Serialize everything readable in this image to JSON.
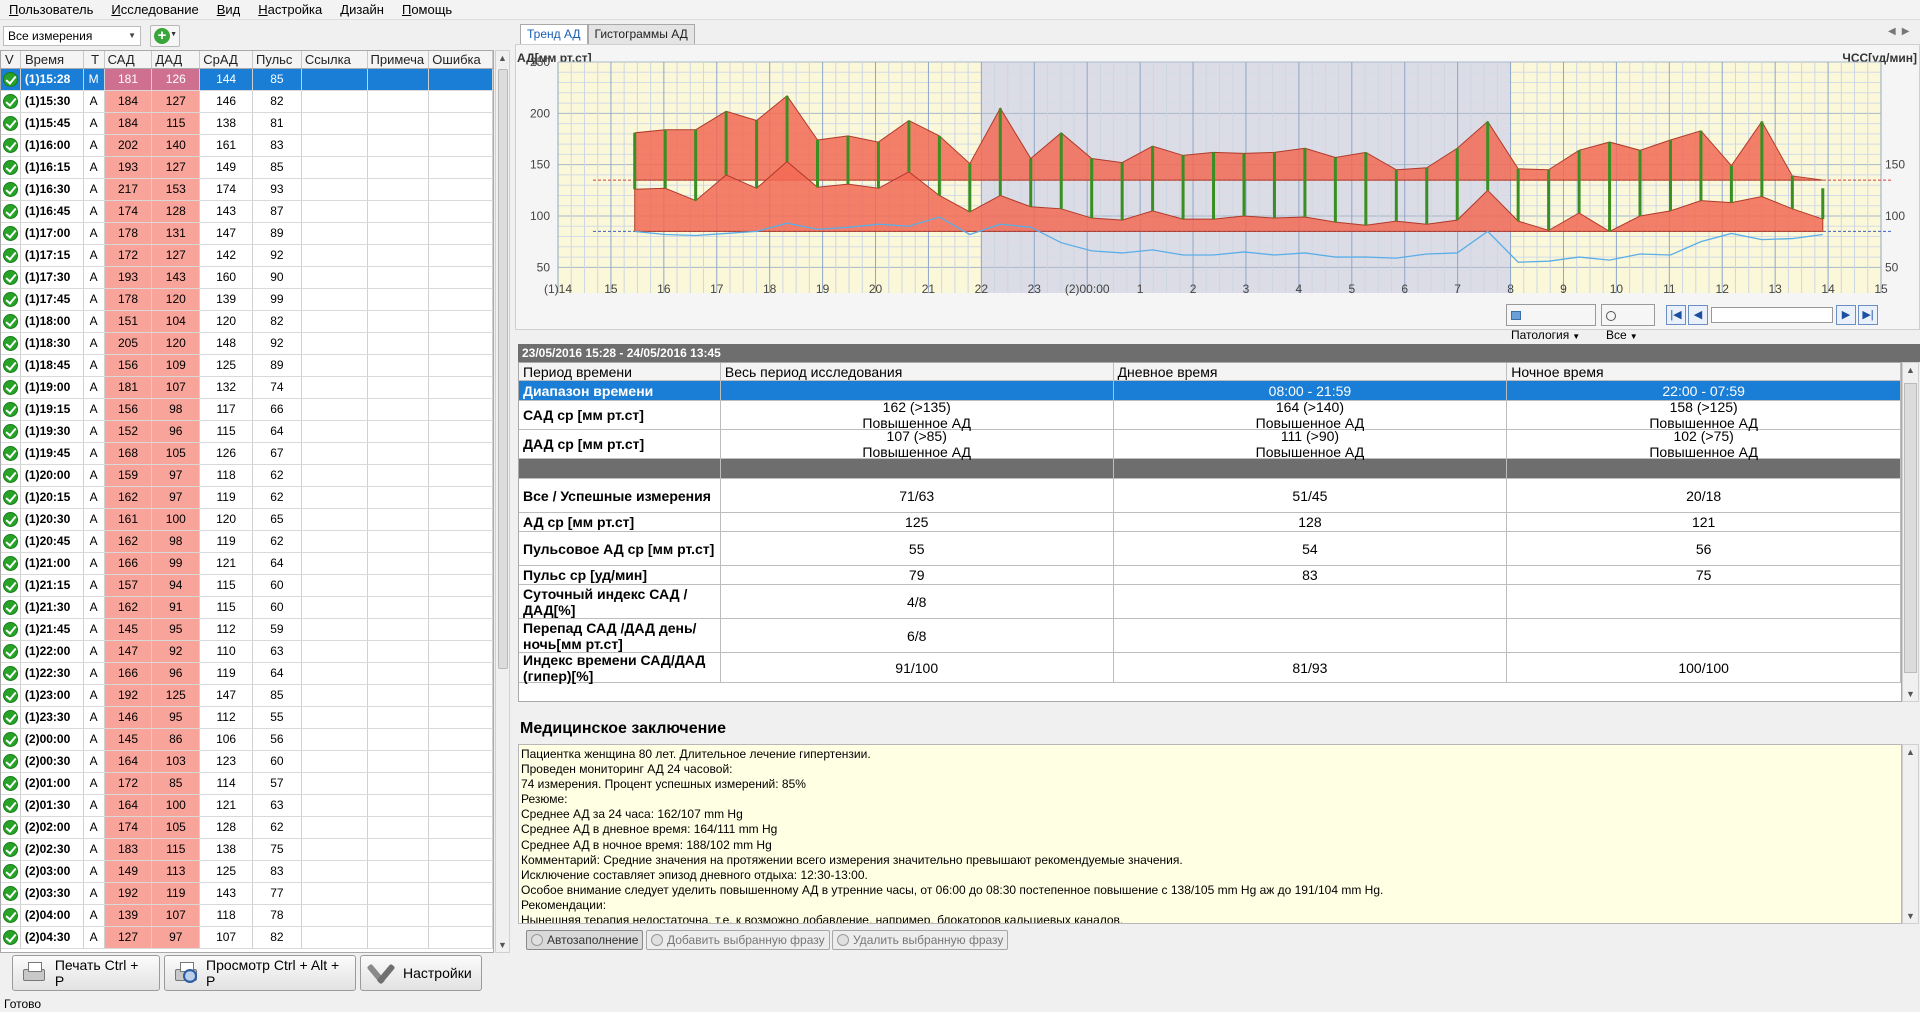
{
  "menu": [
    "Пользователь",
    "Исследование",
    "Вид",
    "Настройка",
    "Дизайн",
    "Помощь"
  ],
  "left": {
    "filter": "Все измерения",
    "columns": [
      "V",
      "Время",
      "T",
      "САД",
      "ДАД",
      "СрАД",
      "Пульс",
      "Ссылка",
      "Примеча",
      "Ошибка"
    ],
    "rows": [
      {
        "time": "(1)15:28",
        "t": "M",
        "sad": "181",
        "dad": "126",
        "srad": "144",
        "pulse": "85",
        "selected": true
      },
      {
        "time": "(1)15:30",
        "t": "A",
        "sad": "184",
        "dad": "127",
        "srad": "146",
        "pulse": "82"
      },
      {
        "time": "(1)15:45",
        "t": "A",
        "sad": "184",
        "dad": "115",
        "srad": "138",
        "pulse": "81"
      },
      {
        "time": "(1)16:00",
        "t": "A",
        "sad": "202",
        "dad": "140",
        "srad": "161",
        "pulse": "83"
      },
      {
        "time": "(1)16:15",
        "t": "A",
        "sad": "193",
        "dad": "127",
        "srad": "149",
        "pulse": "85"
      },
      {
        "time": "(1)16:30",
        "t": "A",
        "sad": "217",
        "dad": "153",
        "srad": "174",
        "pulse": "93"
      },
      {
        "time": "(1)16:45",
        "t": "A",
        "sad": "174",
        "dad": "128",
        "srad": "143",
        "pulse": "87"
      },
      {
        "time": "(1)17:00",
        "t": "A",
        "sad": "178",
        "dad": "131",
        "srad": "147",
        "pulse": "89"
      },
      {
        "time": "(1)17:15",
        "t": "A",
        "sad": "172",
        "dad": "127",
        "srad": "142",
        "pulse": "92"
      },
      {
        "time": "(1)17:30",
        "t": "A",
        "sad": "193",
        "dad": "143",
        "srad": "160",
        "pulse": "90"
      },
      {
        "time": "(1)17:45",
        "t": "A",
        "sad": "178",
        "dad": "120",
        "srad": "139",
        "pulse": "99"
      },
      {
        "time": "(1)18:00",
        "t": "A",
        "sad": "151",
        "dad": "104",
        "srad": "120",
        "pulse": "82"
      },
      {
        "time": "(1)18:30",
        "t": "A",
        "sad": "205",
        "dad": "120",
        "srad": "148",
        "pulse": "92"
      },
      {
        "time": "(1)18:45",
        "t": "A",
        "sad": "156",
        "dad": "109",
        "srad": "125",
        "pulse": "89"
      },
      {
        "time": "(1)19:00",
        "t": "A",
        "sad": "181",
        "dad": "107",
        "srad": "132",
        "pulse": "74"
      },
      {
        "time": "(1)19:15",
        "t": "A",
        "sad": "156",
        "dad": "98",
        "srad": "117",
        "pulse": "66"
      },
      {
        "time": "(1)19:30",
        "t": "A",
        "sad": "152",
        "dad": "96",
        "srad": "115",
        "pulse": "64"
      },
      {
        "time": "(1)19:45",
        "t": "A",
        "sad": "168",
        "dad": "105",
        "srad": "126",
        "pulse": "67"
      },
      {
        "time": "(1)20:00",
        "t": "A",
        "sad": "159",
        "dad": "97",
        "srad": "118",
        "pulse": "62"
      },
      {
        "time": "(1)20:15",
        "t": "A",
        "sad": "162",
        "dad": "97",
        "srad": "119",
        "pulse": "62"
      },
      {
        "time": "(1)20:30",
        "t": "A",
        "sad": "161",
        "dad": "100",
        "srad": "120",
        "pulse": "65"
      },
      {
        "time": "(1)20:45",
        "t": "A",
        "sad": "162",
        "dad": "98",
        "srad": "119",
        "pulse": "62"
      },
      {
        "time": "(1)21:00",
        "t": "A",
        "sad": "166",
        "dad": "99",
        "srad": "121",
        "pulse": "64"
      },
      {
        "time": "(1)21:15",
        "t": "A",
        "sad": "157",
        "dad": "94",
        "srad": "115",
        "pulse": "60"
      },
      {
        "time": "(1)21:30",
        "t": "A",
        "sad": "162",
        "dad": "91",
        "srad": "115",
        "pulse": "60"
      },
      {
        "time": "(1)21:45",
        "t": "A",
        "sad": "145",
        "dad": "95",
        "srad": "112",
        "pulse": "59"
      },
      {
        "time": "(1)22:00",
        "t": "A",
        "sad": "147",
        "dad": "92",
        "srad": "110",
        "pulse": "63"
      },
      {
        "time": "(1)22:30",
        "t": "A",
        "sad": "166",
        "dad": "96",
        "srad": "119",
        "pulse": "64"
      },
      {
        "time": "(1)23:00",
        "t": "A",
        "sad": "192",
        "dad": "125",
        "srad": "147",
        "pulse": "85"
      },
      {
        "time": "(1)23:30",
        "t": "A",
        "sad": "146",
        "dad": "95",
        "srad": "112",
        "pulse": "55"
      },
      {
        "time": "(2)00:00",
        "t": "A",
        "sad": "145",
        "dad": "86",
        "srad": "106",
        "pulse": "56"
      },
      {
        "time": "(2)00:30",
        "t": "A",
        "sad": "164",
        "dad": "103",
        "srad": "123",
        "pulse": "60"
      },
      {
        "time": "(2)01:00",
        "t": "A",
        "sad": "172",
        "dad": "85",
        "srad": "114",
        "pulse": "57"
      },
      {
        "time": "(2)01:30",
        "t": "A",
        "sad": "164",
        "dad": "100",
        "srad": "121",
        "pulse": "63"
      },
      {
        "time": "(2)02:00",
        "t": "A",
        "sad": "174",
        "dad": "105",
        "srad": "128",
        "pulse": "62"
      },
      {
        "time": "(2)02:30",
        "t": "A",
        "sad": "183",
        "dad": "115",
        "srad": "138",
        "pulse": "75"
      },
      {
        "time": "(2)03:00",
        "t": "A",
        "sad": "149",
        "dad": "113",
        "srad": "125",
        "pulse": "83"
      },
      {
        "time": "(2)03:30",
        "t": "A",
        "sad": "192",
        "dad": "119",
        "srad": "143",
        "pulse": "77"
      },
      {
        "time": "(2)04:00",
        "t": "A",
        "sad": "139",
        "dad": "107",
        "srad": "118",
        "pulse": "78"
      },
      {
        "time": "(2)04:30",
        "t": "A",
        "sad": "127",
        "dad": "97",
        "srad": "107",
        "pulse": "82"
      }
    ]
  },
  "buttons": {
    "print": "Печать Ctrl + P",
    "preview": "Просмотр Ctrl + Alt + P",
    "settings": "Настройки"
  },
  "status": "Готово",
  "tabs": [
    "Тренд АД",
    "Гистограммы АД"
  ],
  "chart": {
    "y_left_title": "АД[мм рт.ст]",
    "y_right_title": "ЧСС[уд/мин]",
    "y_ticks": [
      "250",
      "200",
      "150",
      "100",
      "50"
    ],
    "y_right_ticks": [
      "150",
      "100",
      "50"
    ],
    "x_ticks": [
      "(1)14",
      "15",
      "16",
      "17",
      "18",
      "19",
      "20",
      "21",
      "22",
      "23",
      "(2)00:00",
      "1",
      "2",
      "3",
      "4",
      "5",
      "6",
      "7",
      "8",
      "9",
      "10",
      "11",
      "12",
      "13",
      "14",
      "15"
    ],
    "pathology_label": "Патология",
    "filter_label": "Все",
    "colors": {
      "sad": "#f26a55",
      "bar": "#3a8f22",
      "pulse": "#5aaee8",
      "day_bg": "#fbf7d9",
      "night_bg": "#dcdce6"
    }
  },
  "chart_data": {
    "type": "area",
    "series": [
      {
        "name": "САД",
        "values": [
          181,
          184,
          184,
          202,
          193,
          217,
          174,
          178,
          172,
          193,
          178,
          151,
          205,
          156,
          181,
          156,
          152,
          168,
          159,
          162,
          161,
          162,
          166,
          157,
          162,
          145,
          147,
          166,
          192,
          146,
          145,
          164,
          172,
          164,
          174,
          183,
          149,
          192,
          139,
          127
        ]
      },
      {
        "name": "ДАД",
        "values": [
          126,
          127,
          115,
          140,
          127,
          153,
          128,
          131,
          127,
          143,
          120,
          104,
          120,
          109,
          107,
          98,
          96,
          105,
          97,
          97,
          100,
          98,
          99,
          94,
          91,
          95,
          92,
          96,
          125,
          95,
          86,
          103,
          85,
          100,
          105,
          115,
          113,
          119,
          107,
          97
        ]
      },
      {
        "name": "Пульс",
        "values": [
          85,
          82,
          81,
          83,
          85,
          93,
          87,
          89,
          92,
          90,
          99,
          82,
          92,
          89,
          74,
          66,
          64,
          67,
          62,
          62,
          65,
          62,
          64,
          60,
          60,
          59,
          63,
          64,
          85,
          55,
          56,
          60,
          57,
          63,
          62,
          75,
          83,
          77,
          78,
          82
        ]
      }
    ],
    "ylim": [
      25,
      250
    ]
  },
  "summary": {
    "period": "23/05/2016 15:28 - 24/05/2016 13:45",
    "head": [
      "Период времени",
      "Весь период исследования",
      "Дневное время",
      "Ночное время"
    ],
    "range": {
      "label": "Диапазон времени",
      "all": "",
      "day": "08:00 - 21:59",
      "night": "22:00 - 07:59"
    },
    "rows": [
      {
        "label": "САД ср [мм рт.ст]",
        "all": "162 (>135)",
        "all2": "Повышенное АД",
        "day": "164 (>140)",
        "day2": "Повышенное АД",
        "night": "158 (>125)",
        "night2": "Повышенное АД"
      },
      {
        "label": "ДАД ср [мм рт.ст]",
        "all": "107 (>85)",
        "all2": "Повышенное АД",
        "day": "111 (>90)",
        "day2": "Повышенное АД",
        "night": "102 (>75)",
        "night2": "Повышенное АД"
      }
    ],
    "rows2": [
      {
        "label": "Все / Успешные измерения",
        "all": "71/63",
        "day": "51/45",
        "night": "20/18",
        "h": 34
      },
      {
        "label": "АД ср [мм рт.ст]",
        "all": "125",
        "day": "128",
        "night": "121",
        "h": 19
      },
      {
        "label": "Пульсовое АД ср [мм рт.ст]",
        "all": "55",
        "day": "54",
        "night": "56",
        "h": 34
      },
      {
        "label": "Пульс ср [уд/мин]",
        "all": "79",
        "day": "83",
        "night": "75",
        "h": 19
      },
      {
        "label": "Суточный индекс САД /ДАД[%]",
        "all": "4/8",
        "day": "",
        "night": "",
        "h": 34
      },
      {
        "label": "Перепад САД /ДАД день/ночь[мм рт.ст]",
        "all": "6/8",
        "day": "",
        "night": "",
        "h": 34
      },
      {
        "label": "Индекс времени САД/ДАД (гипер)[%]",
        "all": "91/100",
        "day": "81/93",
        "night": "100/100",
        "h": 30
      }
    ]
  },
  "conclusion": {
    "title": "Медицинское заключение",
    "lines": [
      "Пациентка женщина 80 лет. Длительное лечение гипертензии.",
      "Проведен мониторинг АД 24 часовой:",
      "74 измерения. Процент успешных измерений: 85%",
      "Резюме:",
      "Среднее АД за 24 часа: 162/107 mm Hg",
      "Среднее АД в дневное время: 164/111 mm Hg",
      "Среднее АД в ночное время: 188/102 mm Hg",
      "Комментарий: Средние значения на протяжении всего измерения значительно превышают рекомендуемые значения.",
      "Исключение составляет эпизод дневного отдыха:  12:30-13:00.",
      "Особое внимание следует уделить повышенному АД в утренние часы, от 06:00 до 08:30 постепенное повышение с 138/105 mm Hg аж до 191/104 mm Hg.",
      "Рекомендации:",
      "Нынешняя терапия недостаточна, т.е. к возможно добавление, например, блокаторов кальциевых каналов."
    ],
    "autofill": "Автозаполнение",
    "add_phrase": "Добавить выбранную фразу",
    "remove_phrase": "Удалить выбранную фразу"
  }
}
